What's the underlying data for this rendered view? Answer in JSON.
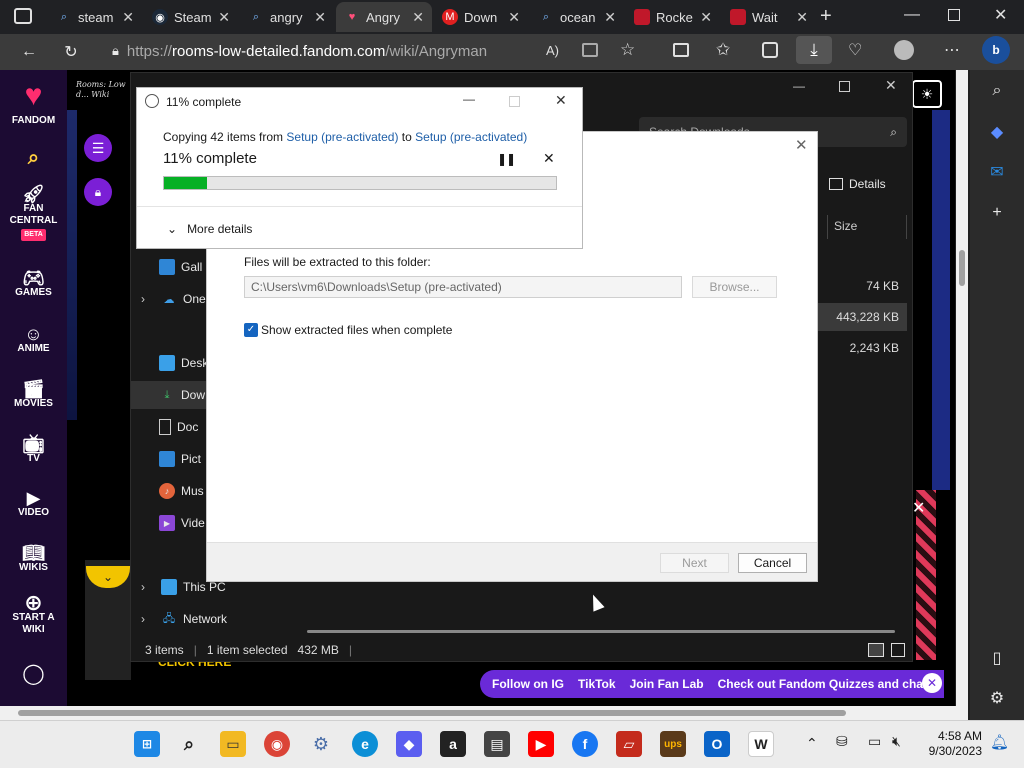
{
  "browser": {
    "tabs": [
      {
        "label": "steam",
        "icon": "search-icon",
        "color": "#7ab8ff"
      },
      {
        "label": "Steam",
        "icon": "steam-icon",
        "color": "#ffffff"
      },
      {
        "label": "angry",
        "icon": "search-icon",
        "color": "#7ab8ff"
      },
      {
        "label": "Angry",
        "icon": "fandom-icon",
        "color": "#ff4f7a"
      },
      {
        "label": "Down",
        "icon": "mega-icon",
        "color": "#ff3030"
      },
      {
        "label": "ocean",
        "icon": "search-icon",
        "color": "#7ab8ff"
      },
      {
        "label": "Rocke",
        "icon": "site-icon",
        "color": "#c0182a"
      },
      {
        "label": "Wait",
        "icon": "site-icon",
        "color": "#c0182a"
      }
    ],
    "url_prefix": "https://",
    "url_host": "rooms-low-detailed.fandom.com",
    "url_path": "/wiki/Angryman"
  },
  "fandom_sidebar": {
    "logo": "FANDOM",
    "items": [
      {
        "label": "FAN CENTRAL",
        "badge": "BETA",
        "icon": "rocket-icon"
      },
      {
        "label": "GAMES",
        "icon": "gamepad-icon"
      },
      {
        "label": "ANIME",
        "icon": "anime-icon"
      },
      {
        "label": "MOVIES",
        "icon": "clapper-icon"
      },
      {
        "label": "TV",
        "icon": "tv-icon"
      },
      {
        "label": "VIDEO",
        "icon": "play-icon"
      },
      {
        "label": "WIKIS",
        "icon": "book-icon"
      },
      {
        "label": "START A WIKI",
        "icon": "plus-circle-icon"
      }
    ],
    "wiki_title": "Rooms: Low d... Wiki"
  },
  "explorer": {
    "search_placeholder": "Search Downloads",
    "details_label": "Details",
    "column_size": "Size",
    "sizes": [
      "74 KB",
      "443,228 KB",
      "2,243 KB"
    ],
    "nav_items": [
      {
        "label": "Gall",
        "icon": "gallery-icon",
        "expandable": false
      },
      {
        "label": "One",
        "icon": "onedrive-icon",
        "expandable": true
      },
      {
        "label": "Desk",
        "icon": "desktop-icon",
        "expandable": false
      },
      {
        "label": "Dow",
        "icon": "download-icon",
        "expandable": false
      },
      {
        "label": "Doc",
        "icon": "document-icon",
        "expandable": false
      },
      {
        "label": "Pict",
        "icon": "pictures-icon",
        "expandable": false
      },
      {
        "label": "Mus",
        "icon": "music-icon",
        "expandable": false
      },
      {
        "label": "Vide",
        "icon": "video-icon",
        "expandable": false
      },
      {
        "label": "This PC",
        "icon": "pc-icon",
        "expandable": true
      },
      {
        "label": "Network",
        "icon": "network-icon",
        "expandable": true
      }
    ],
    "status_items": "3 items",
    "status_selected": "1 item selected",
    "status_size": "432 MB"
  },
  "extract_dialog": {
    "folder_label": "Files will be extracted to this folder:",
    "folder_path": "C:\\Users\\vm6\\Downloads\\Setup (pre-activated)",
    "browse_label": "Browse...",
    "show_files_label": "Show extracted files when complete",
    "show_files_checked": true,
    "next_label": "Next",
    "cancel_label": "Cancel"
  },
  "progress_dialog": {
    "title": "11% complete",
    "copying_prefix": "Copying 42 items from ",
    "source": "Setup (pre-activated)",
    "to_word": " to ",
    "destination": "Setup (pre-activated)",
    "heading": "11% complete",
    "progress_fraction": 0.11,
    "more_details": "More details"
  },
  "fandom_footer": {
    "links": [
      "Follow on IG",
      "TikTok",
      "Join Fan Lab",
      "Check out Fandom Quizzes and cha"
    ]
  },
  "wiki_ad": {
    "text": "CLICK HERE"
  },
  "taskbar": {
    "time": "4:58 AM",
    "date": "9/30/2023"
  }
}
